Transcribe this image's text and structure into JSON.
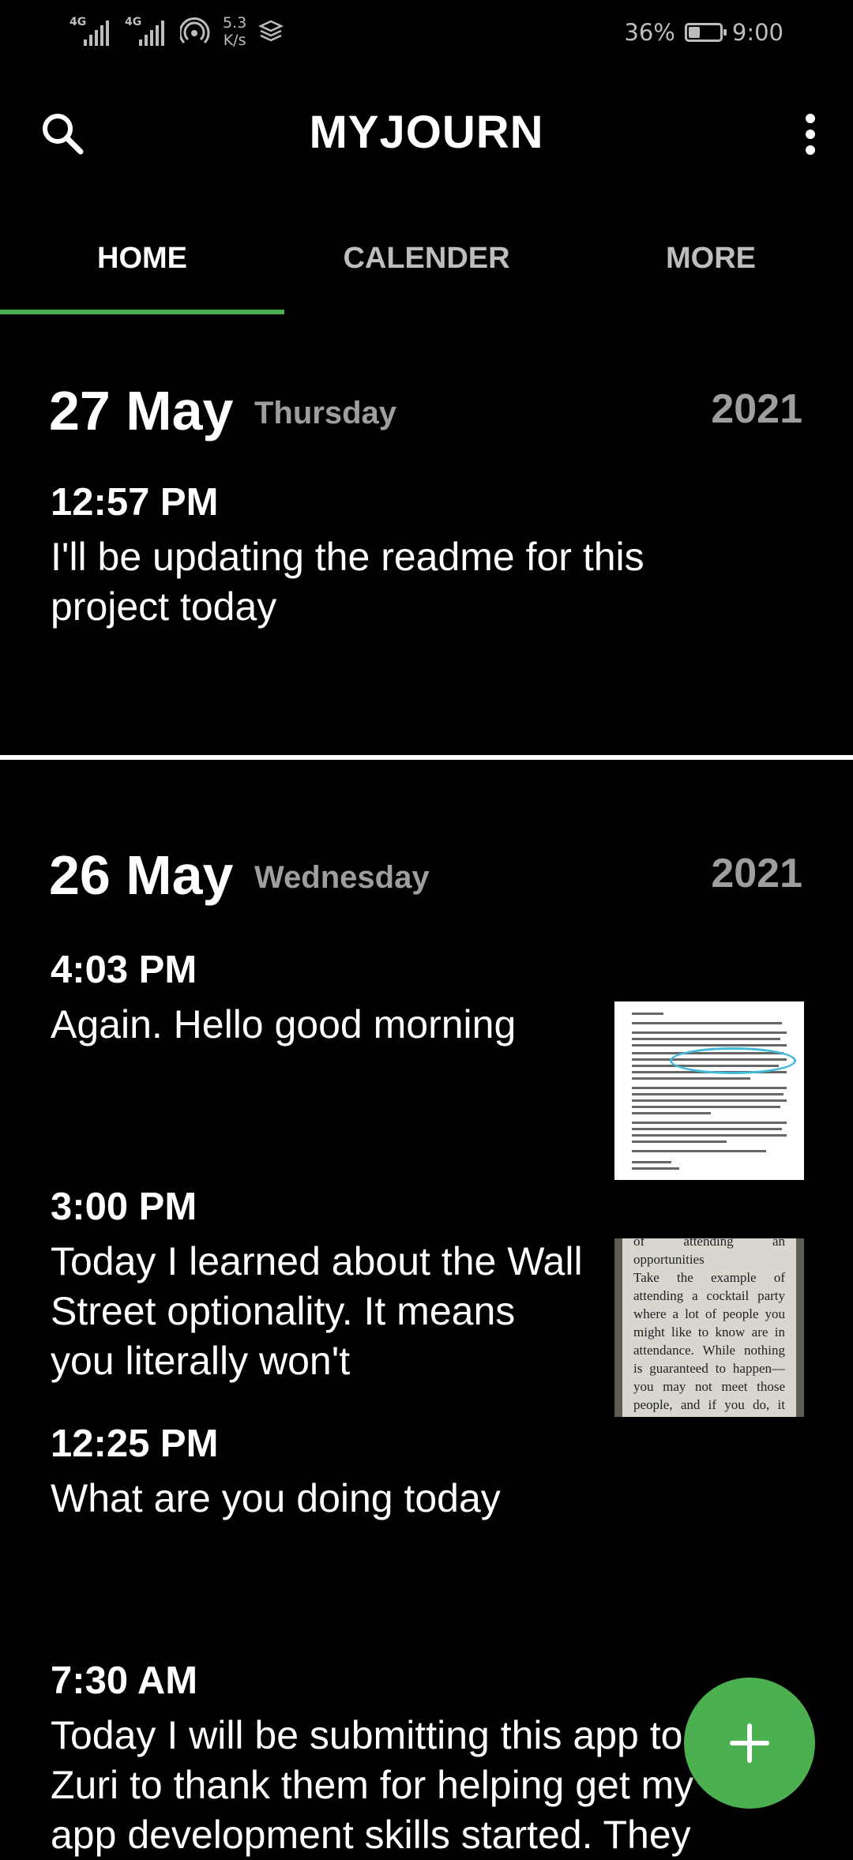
{
  "status_bar": {
    "signal1": "4G",
    "signal2": "4G",
    "speed_value": "5.3",
    "speed_unit": "K/s",
    "battery_percent": "36%",
    "battery_level": 0.36,
    "time": "9:00"
  },
  "app": {
    "title": "MYJOURN",
    "search_icon": "search-icon",
    "menu_icon": "more-vert-icon",
    "accent_color": "#4caf50"
  },
  "tabs": [
    {
      "label": "HOME",
      "active": true
    },
    {
      "label": "CALENDER",
      "active": false
    },
    {
      "label": "MORE",
      "active": false
    }
  ],
  "days": [
    {
      "date": "27 May",
      "weekday": "Thursday",
      "year": "2021",
      "entries": [
        {
          "time": "12:57 PM",
          "text": "I'll be updating the readme for this project today"
        }
      ]
    },
    {
      "date": "26 May",
      "weekday": "Wednesday",
      "year": "2021",
      "entries": [
        {
          "time": "4:03 PM",
          "text": "Again. Hello good morning"
        },
        {
          "time": "3:00 PM",
          "text": "Today I learned about the Wall Street optionality. It means you literally won't"
        },
        {
          "time": "12:25 PM",
          "text": "What are you doing today"
        },
        {
          "time": "7:30 AM",
          "text": "Today I will be submitting this app to Zuri to thank them for helping get my app development skills started. They"
        }
      ]
    }
  ],
  "thumbnails": {
    "book_text": "of attending an opportunities\nTake the example of attending a cocktail party where a lot of people you might like to know are in attendance. While nothing is guaranteed to happen— you may not meet those people, and if you do, it may not go well— you give yourself the benefit of serendipity and"
  },
  "fab": {
    "icon": "plus-icon"
  }
}
